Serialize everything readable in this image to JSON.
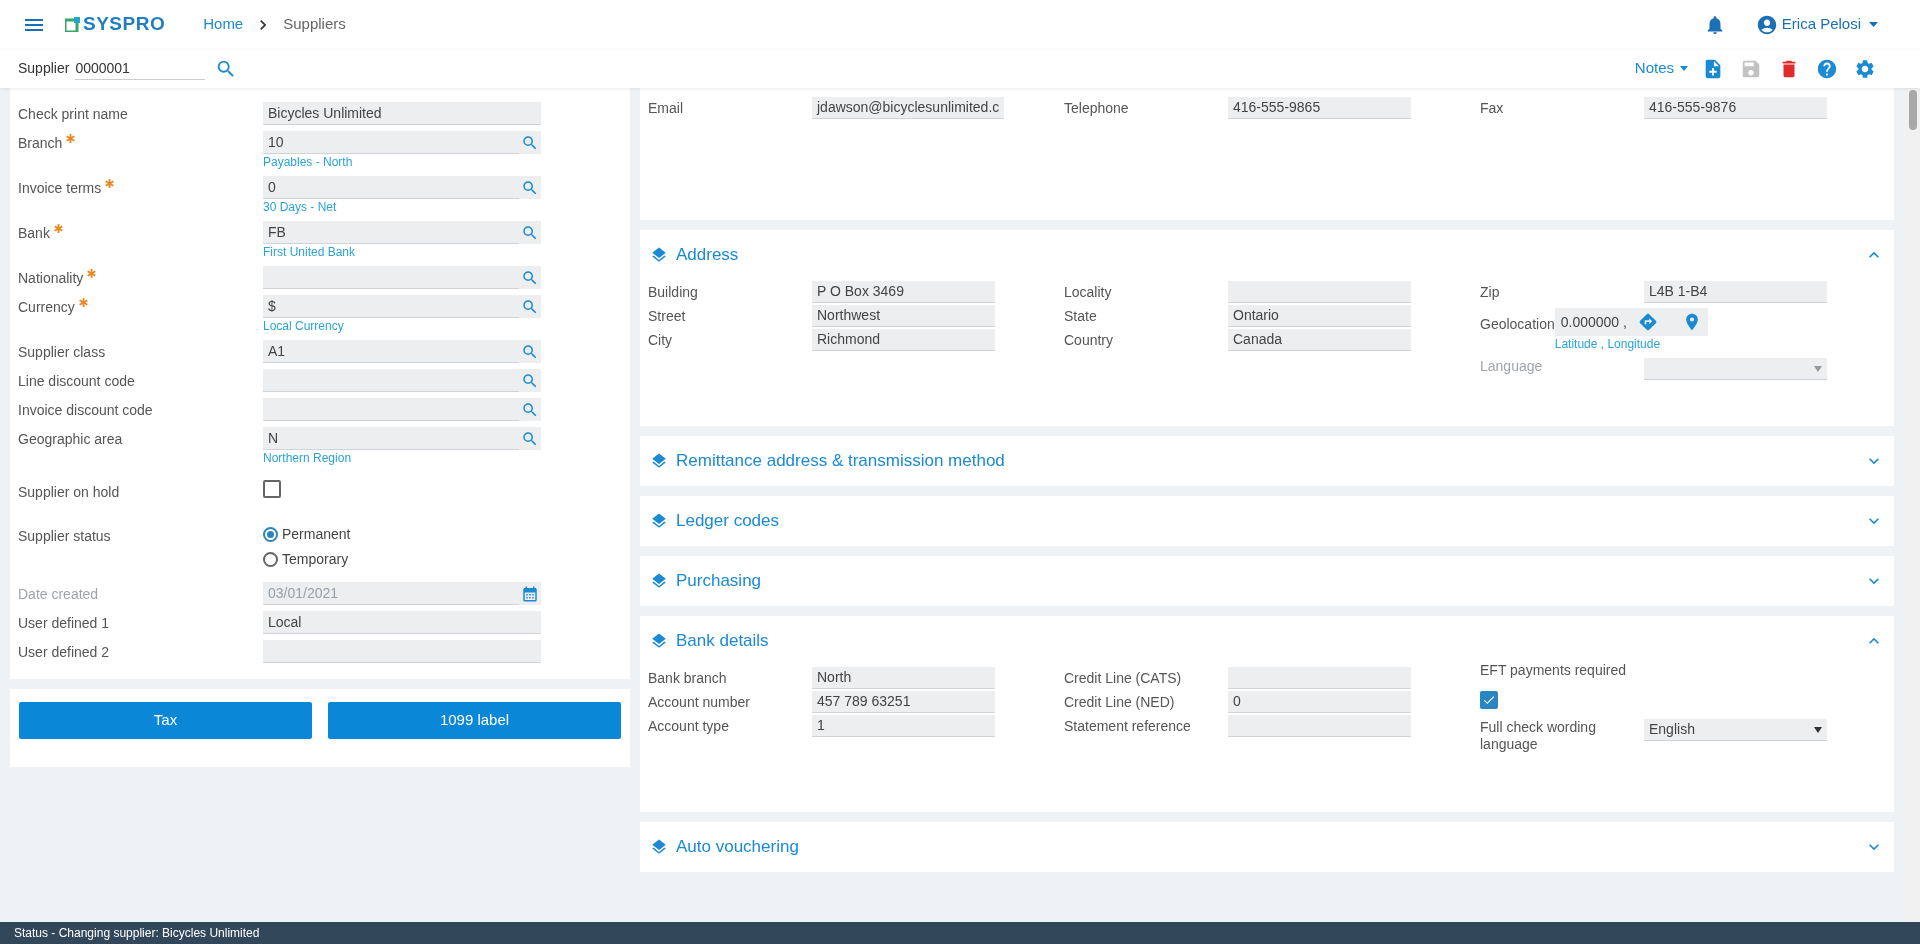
{
  "header": {
    "logo": "SYSPRO",
    "breadcrumbs": [
      "Home",
      "Suppliers"
    ],
    "user": "Erica Pelosi"
  },
  "toolbar": {
    "supplier_label": "Supplier",
    "supplier_value": "0000001",
    "notes": "Notes"
  },
  "supplier_form": {
    "fields": [
      {
        "kind": "text",
        "label": "Check print name",
        "value": "Bicycles Unlimited",
        "required": false,
        "disabled": false
      },
      {
        "kind": "lookup",
        "label": "Branch",
        "value": "10",
        "hint": "Payables - North",
        "required": true,
        "disabled": false
      },
      {
        "kind": "lookup",
        "label": "Invoice terms",
        "value": "0",
        "hint": "30 Days - Net",
        "required": true,
        "disabled": false
      },
      {
        "kind": "lookup",
        "label": "Bank",
        "value": "FB",
        "hint": "First United Bank",
        "required": true,
        "disabled": false
      },
      {
        "kind": "lookup",
        "label": "Nationality",
        "required": true,
        "disabled": false
      },
      {
        "kind": "lookup",
        "label": "Currency",
        "value": "$",
        "hint": "Local Currency",
        "required": true,
        "disabled": false
      },
      {
        "kind": "lookup",
        "label": "Supplier class",
        "value": "A1",
        "required": false,
        "disabled": false
      },
      {
        "kind": "lookup",
        "label": "Line discount code",
        "required": false,
        "disabled": false
      },
      {
        "kind": "lookup",
        "label": "Invoice discount code",
        "required": false,
        "disabled": false
      },
      {
        "kind": "lookup",
        "label": "Geographic area",
        "value": "N",
        "hint": "Northern Region",
        "required": false,
        "disabled": false
      },
      {
        "kind": "checkbox",
        "label": "Supplier on hold",
        "checked": false,
        "required": false,
        "disabled": false
      },
      {
        "kind": "radio",
        "label": "Supplier status",
        "options": [
          {
            "label": "Permanent",
            "selected": true
          },
          {
            "label": "Temporary",
            "selected": false
          }
        ],
        "required": false,
        "disabled": false
      },
      {
        "kind": "date",
        "label": "Date created",
        "value": "03/01/2021",
        "required": false,
        "disabled": true
      },
      {
        "kind": "text",
        "label": "User defined 1",
        "value": "Local",
        "required": false,
        "disabled": false
      },
      {
        "kind": "text",
        "label": "User defined 2",
        "required": false,
        "disabled": false
      }
    ]
  },
  "buttons": [
    "Tax",
    "1099 label"
  ],
  "contact": {
    "columns": [
      [
        {
          "kind": "text",
          "label": "Email",
          "value": "jdawson@bicyclesunlimited.c",
          "disabled": false
        }
      ],
      [
        {
          "kind": "text",
          "label": "Telephone",
          "value": "416-555-9865",
          "disabled": false
        }
      ],
      [
        {
          "kind": "text",
          "label": "Fax",
          "value": "416-555-9876",
          "disabled": false
        }
      ]
    ]
  },
  "sections": [
    {
      "title": "Address",
      "expanded": true,
      "columns": [
        [
          {
            "kind": "text",
            "label": "Building",
            "value": "P O Box 3469",
            "disabled": false
          },
          {
            "kind": "text",
            "label": "Street",
            "value": "Northwest",
            "disabled": false
          },
          {
            "kind": "text",
            "label": "City",
            "value": "Richmond",
            "disabled": false
          }
        ],
        [
          {
            "kind": "text",
            "label": "Locality",
            "disabled": false
          },
          {
            "kind": "text",
            "label": "State",
            "value": "Ontario",
            "disabled": false
          },
          {
            "kind": "text",
            "label": "Country",
            "value": "Canada",
            "disabled": false
          }
        ],
        [
          {
            "kind": "text",
            "label": "Zip",
            "value": "L4B 1-B4",
            "disabled": false
          },
          {
            "kind": "geo",
            "label": "Geolocation",
            "value": "0.000000 ,",
            "hint": "Latitude , Longitude",
            "disabled": false
          },
          {
            "kind": "select",
            "label": "Language",
            "disabled": true
          }
        ]
      ]
    },
    {
      "title": "Remittance address & transmission method",
      "expanded": false
    },
    {
      "title": "Ledger codes",
      "expanded": false
    },
    {
      "title": "Purchasing",
      "expanded": false
    },
    {
      "title": "Bank details",
      "expanded": true,
      "columns": [
        [
          {
            "kind": "text",
            "label": "Bank branch",
            "value": "North",
            "disabled": false
          },
          {
            "kind": "text",
            "label": "Account number",
            "value": "457 789 63251",
            "disabled": false
          },
          {
            "kind": "text",
            "label": "Account type",
            "value": "1",
            "disabled": false
          }
        ],
        [
          {
            "kind": "text",
            "label": "Credit Line (CATS)",
            "disabled": false
          },
          {
            "kind": "text",
            "label": "Credit Line (NED)",
            "value": "0",
            "disabled": false
          },
          {
            "kind": "text",
            "label": "Statement reference",
            "disabled": false
          }
        ],
        [
          {
            "kind": "checkbox",
            "label": "EFT payments required",
            "checked": true,
            "disabled": false
          },
          {
            "kind": "select",
            "label": "Full check wording language",
            "value": "English",
            "disabled": false
          }
        ]
      ]
    },
    {
      "title": "Auto vouchering",
      "expanded": false
    }
  ],
  "status_bar": "Status - Changing supplier: Bicycles Unlimited"
}
